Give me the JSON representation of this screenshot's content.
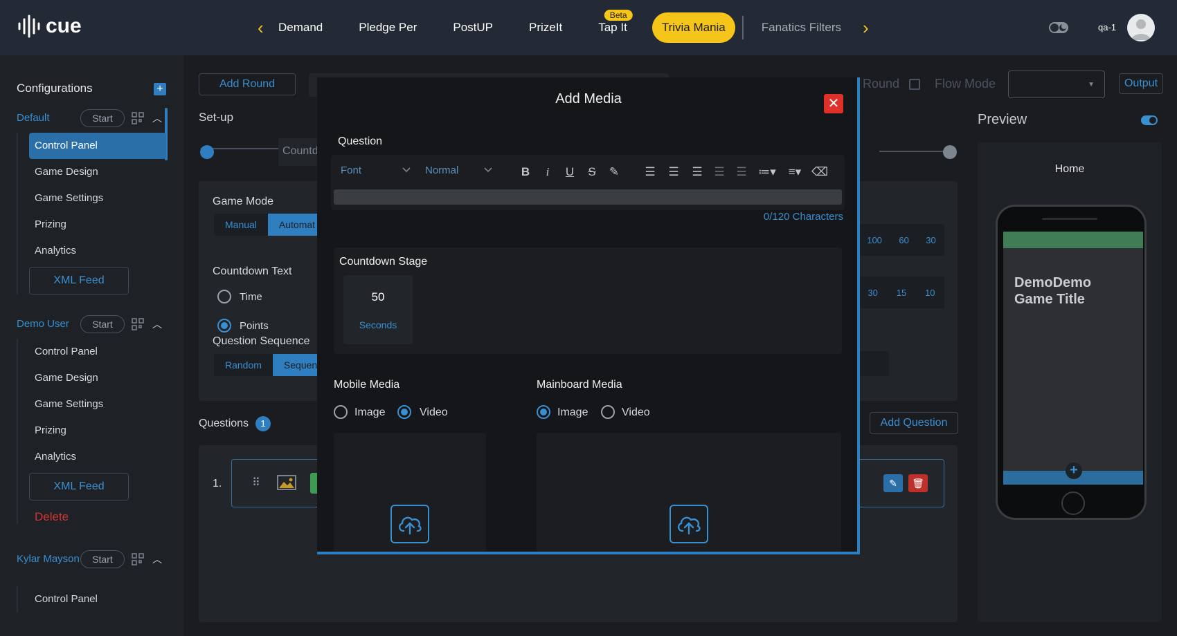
{
  "brand": {
    "name": "cue"
  },
  "nav": {
    "tabs": [
      "Demand",
      "Pledge Per",
      "PostUP",
      "PrizeIt",
      "Tap It",
      "Trivia Mania",
      "Fanatics Filters"
    ],
    "beta_label": "Beta",
    "active_tab": "Trivia Mania"
  },
  "user": {
    "name": "qa-1"
  },
  "sidebar": {
    "title": "Configurations",
    "groups": [
      {
        "name": "Default",
        "start": "Start",
        "items": [
          "Control Panel",
          "Game Design",
          "Game Settings",
          "Prizing",
          "Analytics"
        ],
        "xml": "XML Feed"
      },
      {
        "name": "Demo User",
        "start": "Start",
        "items": [
          "Control Panel",
          "Game Design",
          "Game Settings",
          "Prizing",
          "Analytics"
        ],
        "xml": "XML Feed",
        "delete": "Delete"
      },
      {
        "name": "Kylar Mayson",
        "start": "Start",
        "items": [
          "Control Panel"
        ]
      }
    ]
  },
  "main": {
    "add_round": "Add Round",
    "setup_label": "Set-up",
    "countdown_partial": "Countd",
    "game_mode": {
      "label": "Game Mode",
      "options": [
        "Manual",
        "Automat"
      ]
    },
    "countdown_text": {
      "label": "Countdown Text",
      "options": [
        "Time",
        "Points"
      ]
    },
    "question_sequence": {
      "label": "Question Sequence",
      "options": [
        "Random",
        "Sequen"
      ]
    },
    "questions": {
      "label": "Questions",
      "count": "1"
    },
    "add_question": "Add Question",
    "row_number": "1.",
    "round_label": "Round",
    "flow_mode_label": "Flow Mode",
    "output_label": "Output",
    "points_row_1": [
      "100",
      "60",
      "30"
    ],
    "points_row_2": [
      "30",
      "15",
      "10"
    ]
  },
  "preview": {
    "title": "Preview",
    "home": "Home",
    "game_title": "DemoDemo Game Title"
  },
  "modal": {
    "title": "Add Media",
    "question_label": "Question",
    "font_select": "Font",
    "size_select": "Normal",
    "char_count": "0/120 Characters",
    "countdown": {
      "label": "Countdown Stage",
      "value": "50",
      "unit": "Seconds"
    },
    "mobile_media": {
      "label": "Mobile Media",
      "options": [
        "Image",
        "Video"
      ],
      "selected": "Video"
    },
    "mainboard_media": {
      "label": "Mainboard Media",
      "options": [
        "Image",
        "Video"
      ],
      "selected": "Image"
    }
  },
  "colors": {
    "accent": "#2f7fc0",
    "active_tab": "#f5c51a",
    "close": "#e0302a",
    "danger": "#d13232"
  }
}
